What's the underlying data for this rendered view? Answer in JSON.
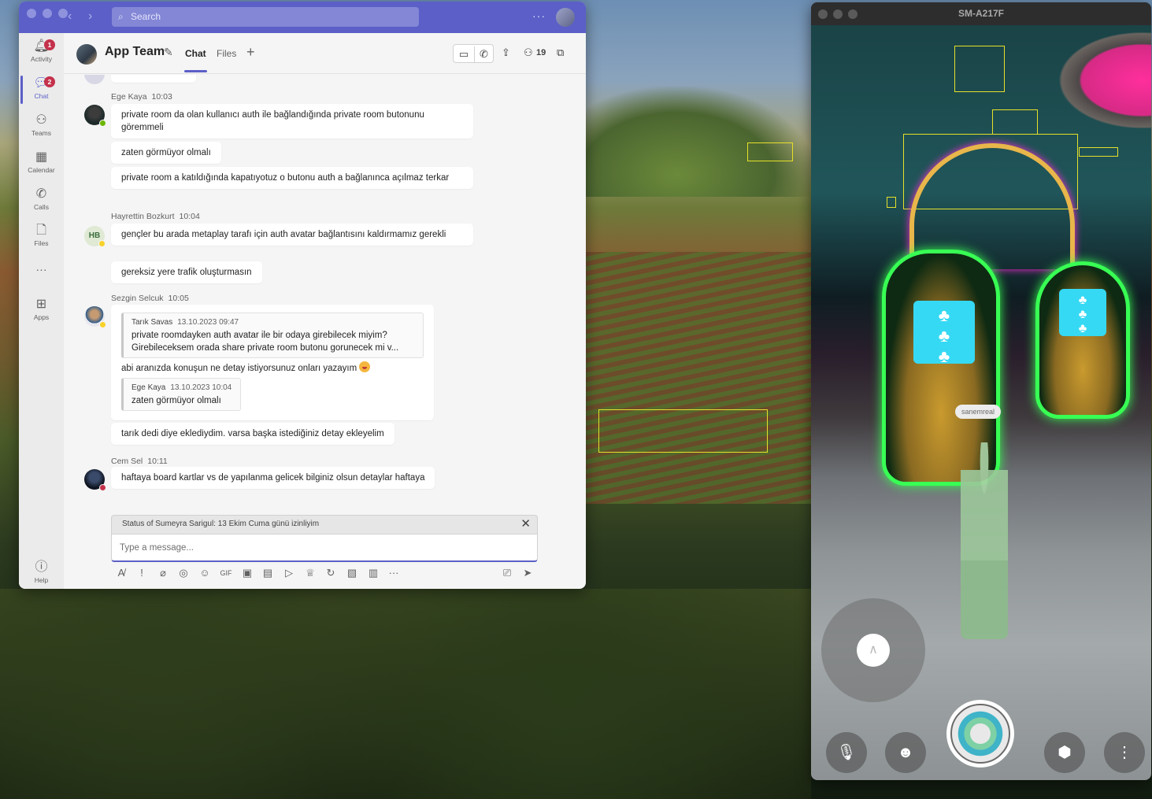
{
  "teams": {
    "search_placeholder": "Search",
    "more": "···",
    "rail": [
      {
        "label": "Activity",
        "icon": "bell-icon",
        "badge": "1"
      },
      {
        "label": "Chat",
        "icon": "chat-icon",
        "badge": "2"
      },
      {
        "label": "Teams",
        "icon": "teams-icon"
      },
      {
        "label": "Calendar",
        "icon": "calendar-icon"
      },
      {
        "label": "Calls",
        "icon": "phone-icon"
      },
      {
        "label": "Files",
        "icon": "file-icon"
      },
      {
        "label": "···",
        "icon": "more-icon"
      },
      {
        "label": "Apps",
        "icon": "apps-icon"
      },
      {
        "label": "Help",
        "icon": "help-icon"
      }
    ],
    "header": {
      "title": "App Team",
      "tabs": [
        "Chat",
        "Files"
      ],
      "participants": "19"
    },
    "messages": [
      {
        "author": "Ege Kaya",
        "time": "10:03",
        "texts": [
          "private room da olan kullanıcı auth ile bağlandığında private room butonunu göremmeli",
          "zaten görmüyor olmalı",
          "private room a katıldığında kapatıyotuz o butonu auth a bağlanınca açılmaz terkar"
        ]
      },
      {
        "author": "Hayrettin Bozkurt",
        "initials": "HB",
        "time": "10:04",
        "texts": [
          "gençler bu arada metaplay tarafı için auth avatar  bağlantısını kaldırmamız gerekli",
          "gereksiz yere trafik oluşturmasın"
        ]
      },
      {
        "author": "Sezgin Selcuk",
        "time": "10:05",
        "quote1": {
          "author": "Tarık Savas",
          "time": "13.10.2023 09:47",
          "text": "private roomdayken auth avatar ile bir odaya girebilecek miyim? Girebileceksem orada share private room butonu gorunecek mi v..."
        },
        "text1": "abi aranızda konuşun ne detay istiyorsunuz onları yazayım",
        "quote2": {
          "author": "Ege Kaya",
          "time": "13.10.2023 10:04",
          "text": "zaten görmüyor olmalı"
        },
        "text2": "tarık dedi diye ekledіydim. varsa başka istediğiniz detay ekleyelim"
      },
      {
        "author": "Cem Sel",
        "time": "10:11",
        "texts": [
          "haftaya board kartlar vs de yapılanma gelicek bilginiz olsun detaylar haftaya"
        ]
      }
    ],
    "status_banner": "Status of Sumeyra Sarigul: 13 Ekim Cuma günü izinliyim",
    "composer_placeholder": "Type a message..."
  },
  "android": {
    "title": "SM-A217F",
    "nametag": "sanemreal"
  },
  "colors": {
    "teams_brand": "#5b5fc7",
    "badge_red": "#c4314b",
    "presence_available": "#6bb700",
    "presence_away": "#f8d22a",
    "presence_busy": "#c4314b"
  }
}
